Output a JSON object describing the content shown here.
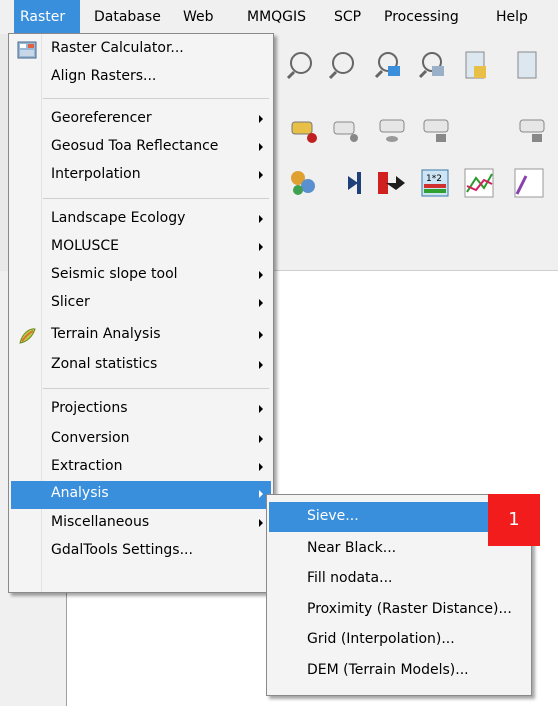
{
  "menubar": {
    "items": [
      {
        "label": "Raster",
        "active": true
      },
      {
        "label": "Database"
      },
      {
        "label": "Web"
      },
      {
        "label": "MMQGIS"
      },
      {
        "label": "SCP"
      },
      {
        "label": "Processing"
      },
      {
        "label": "Help"
      }
    ]
  },
  "raster_menu": {
    "items": [
      {
        "label": "Raster Calculator...",
        "icon": "raster-calculator-icon"
      },
      {
        "label": "Align Rasters..."
      },
      {
        "label": "Georeferencer",
        "submenu": true
      },
      {
        "label": "Geosud Toa Reflectance",
        "submenu": true
      },
      {
        "label": "Interpolation",
        "submenu": true
      },
      {
        "label": "Landscape Ecology",
        "submenu": true
      },
      {
        "label": "MOLUSCE",
        "submenu": true
      },
      {
        "label": "Seismic slope tool",
        "submenu": true
      },
      {
        "label": "Slicer",
        "submenu": true
      },
      {
        "label": "Terrain Analysis",
        "submenu": true,
        "icon": "terrain-analysis-icon"
      },
      {
        "label": "Zonal statistics",
        "submenu": true
      },
      {
        "label": "Projections",
        "submenu": true
      },
      {
        "label": "Conversion",
        "submenu": true
      },
      {
        "label": "Extraction",
        "submenu": true
      },
      {
        "label": "Analysis",
        "submenu": true,
        "highlighted": true
      },
      {
        "label": "Miscellaneous",
        "submenu": true
      },
      {
        "label": "GdalTools Settings..."
      }
    ]
  },
  "analysis_submenu": {
    "items": [
      {
        "label": "Sieve...",
        "highlighted": true
      },
      {
        "label": "Near Black..."
      },
      {
        "label": "Fill nodata..."
      },
      {
        "label": "Proximity (Raster Distance)..."
      },
      {
        "label": "Grid (Interpolation)..."
      },
      {
        "label": "DEM (Terrain Models)..."
      }
    ]
  },
  "annotation": {
    "badge_label": "1",
    "color": "#f21c1c"
  },
  "colors": {
    "highlight": "#3a8fdc",
    "menu_bg": "#f4f4f4"
  }
}
